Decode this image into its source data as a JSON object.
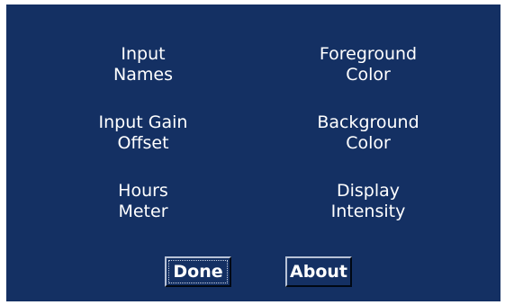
{
  "menu": {
    "input_names": {
      "line1": "Input",
      "line2": "Names"
    },
    "foreground_color": {
      "line1": "Foreground",
      "line2": "Color"
    },
    "input_gain_offset": {
      "line1": "Input Gain",
      "line2": "Offset"
    },
    "background_color": {
      "line1": "Background",
      "line2": "Color"
    },
    "hours_meter": {
      "line1": "Hours",
      "line2": "Meter"
    },
    "display_intensity": {
      "line1": "Display",
      "line2": "Intensity"
    }
  },
  "buttons": {
    "done_label": "Done",
    "about_label": "About"
  },
  "colors": {
    "background": "#143063",
    "text": "#ffffff"
  }
}
